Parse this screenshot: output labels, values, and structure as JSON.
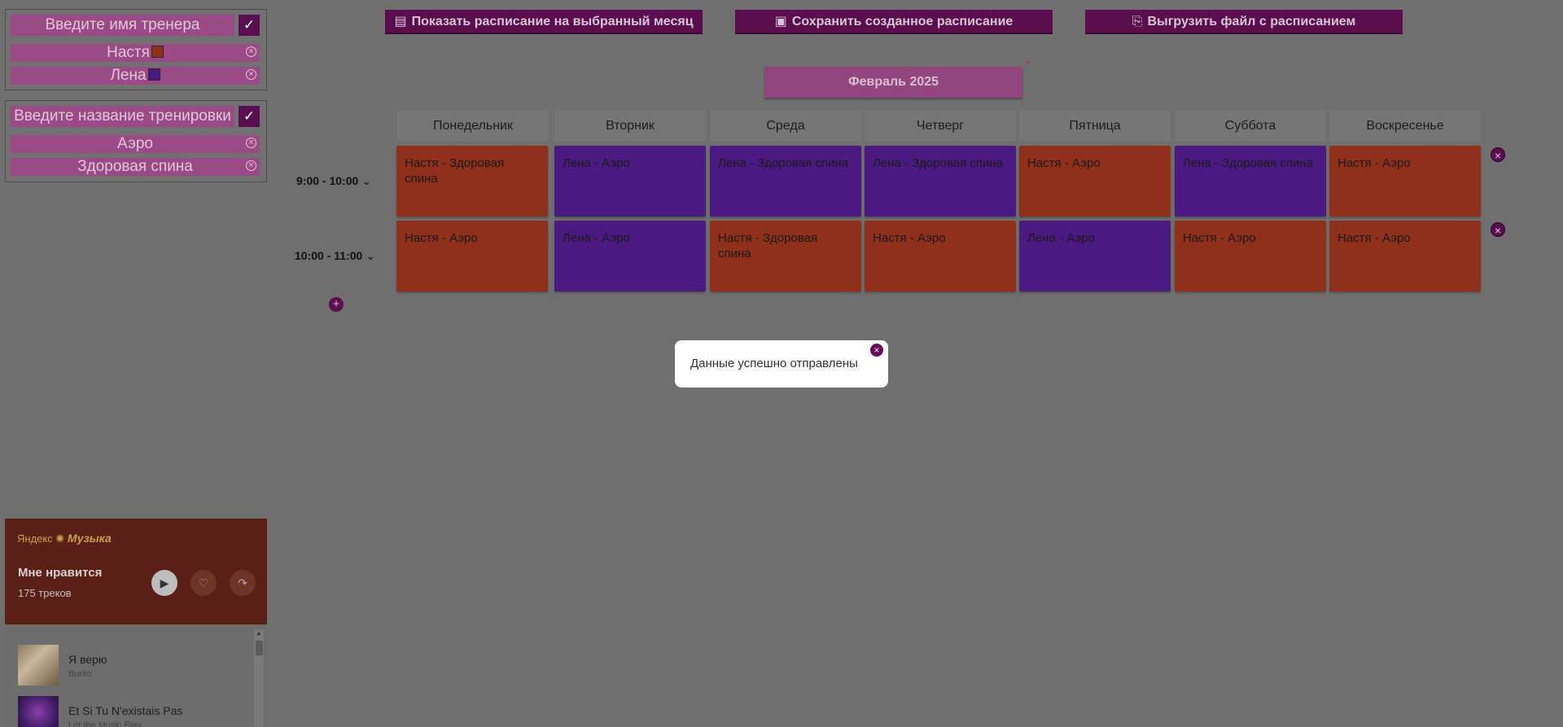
{
  "trainers_panel": {
    "input_placeholder": "Введите имя тренера",
    "confirm_label": "✓",
    "items": [
      {
        "label": "Настя",
        "color": "#8e301a"
      },
      {
        "label": "Лена",
        "color": "#4a1a80"
      }
    ]
  },
  "trainings_panel": {
    "input_placeholder": "Введите название тренировки",
    "confirm_label": "✓",
    "items": [
      {
        "label": "Аэро"
      },
      {
        "label": "Здоровая спина"
      }
    ]
  },
  "toolbar": {
    "show_schedule": "Показать расписание на выбранный месяц",
    "save_schedule": "Сохранить созданное расписание",
    "export_file": "Выгрузить файл с расписанием"
  },
  "month_label": "Февраль 2025",
  "days": [
    "Понедельник",
    "Вторник",
    "Среда",
    "Четверг",
    "Пятница",
    "Суббота",
    "Воскресенье"
  ],
  "rows": [
    {
      "time": "9:00 - 10:00",
      "cells": [
        {
          "text": "Настя - Здоровая спина",
          "trainer": "Настя"
        },
        {
          "text": "Лена - Аэро",
          "trainer": "Лена"
        },
        {
          "text": "Лена - Здоровая спина",
          "trainer": "Лена"
        },
        {
          "text": "Лена - Здоровая спина",
          "trainer": "Лена"
        },
        {
          "text": "Настя - Аэро",
          "trainer": "Настя"
        },
        {
          "text": "Лена - Здоровая спина",
          "trainer": "Лена"
        },
        {
          "text": "Настя - Аэро",
          "trainer": "Настя"
        }
      ]
    },
    {
      "time": "10:00 - 11:00",
      "cells": [
        {
          "text": "Настя - Аэро",
          "trainer": "Настя"
        },
        {
          "text": "Лена - Аэро",
          "trainer": "Лена"
        },
        {
          "text": "Настя - Здоровая спина",
          "trainer": "Настя"
        },
        {
          "text": "Настя - Аэро",
          "trainer": "Настя"
        },
        {
          "text": "Лена - Аэро",
          "trainer": "Лена"
        },
        {
          "text": "Настя - Аэро",
          "trainer": "Настя"
        },
        {
          "text": "Настя - Аэро",
          "trainer": "Настя"
        }
      ]
    }
  ],
  "toast": {
    "message": "Данные успешно отправлены"
  },
  "music": {
    "brand_prefix": "Яндекс",
    "brand_name": "Музыка",
    "playlist_title": "Мне нравится",
    "playlist_count": "175 треков",
    "tracks": [
      {
        "title": "Я верю",
        "artist": "Burito"
      },
      {
        "title": "Et Si Tu N'existais Pas",
        "artist": "Let the Music Play"
      }
    ]
  }
}
